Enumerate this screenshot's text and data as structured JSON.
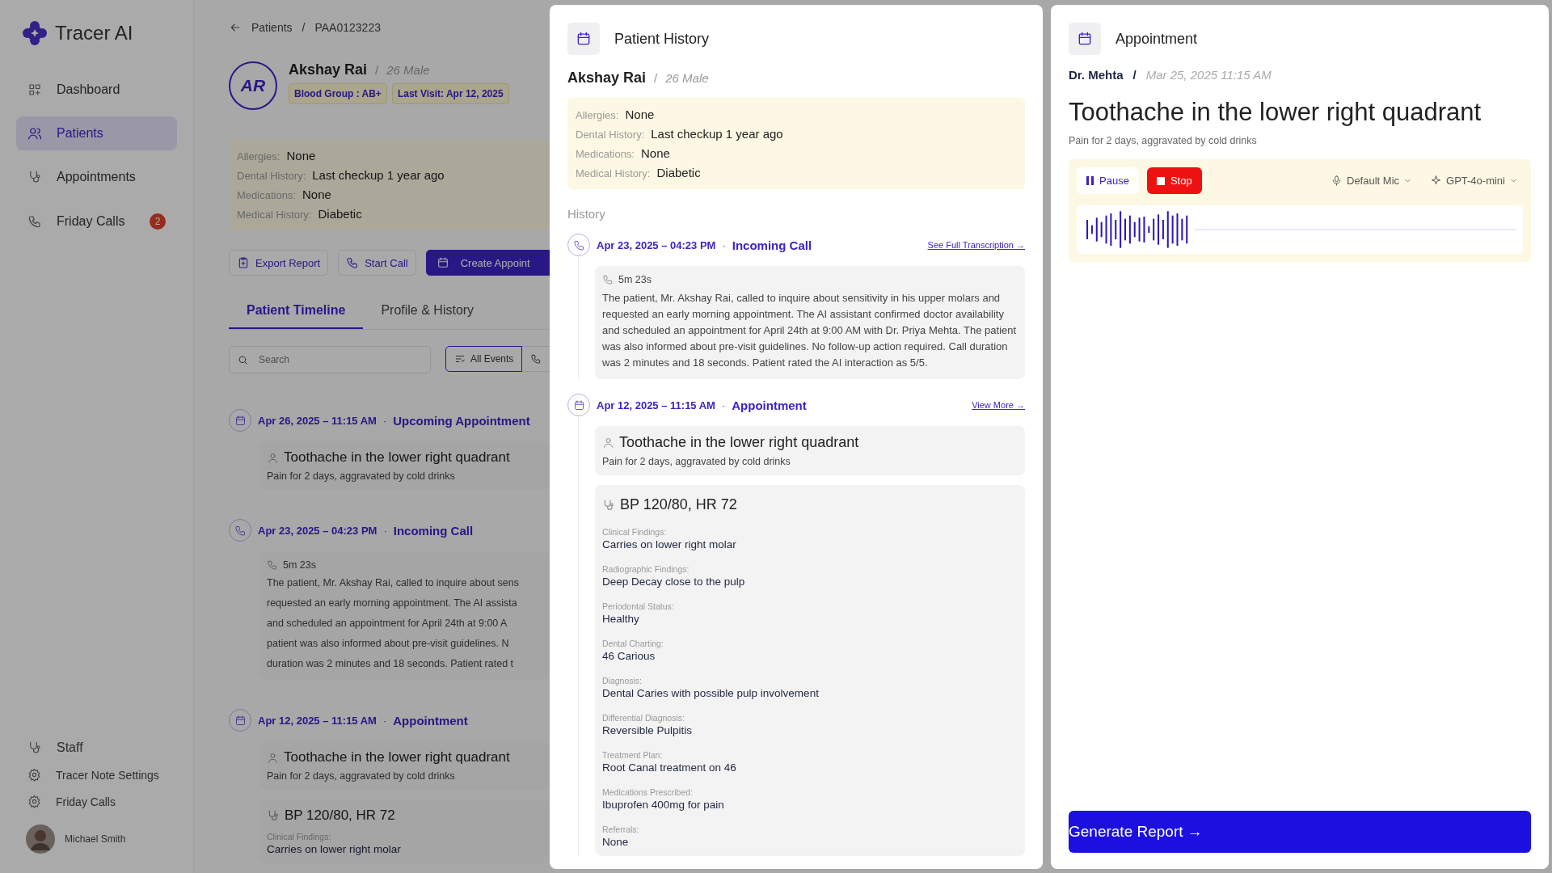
{
  "sidebar": {
    "brand": "Tracer AI",
    "nav": [
      {
        "label": "Dashboard",
        "selected": false
      },
      {
        "label": "Patients",
        "selected": true
      },
      {
        "label": "Appointments",
        "selected": false
      },
      {
        "label": "Friday Calls",
        "selected": false,
        "badge": "2"
      }
    ],
    "footer_nav": [
      {
        "label": "Staff"
      },
      {
        "label": "Tracer Note Settings"
      },
      {
        "label": "Friday Calls"
      }
    ],
    "user": {
      "name": "Michael Smith"
    }
  },
  "background": {
    "breadcrumb": [
      "Patients",
      "/",
      "PAA0123223"
    ],
    "patient": {
      "initials": "AR",
      "name": "Akshay Rai",
      "separator": "/",
      "meta": "26 Male",
      "badges": [
        "Blood Group : AB+",
        "Last Visit: Apr 12, 2025"
      ]
    },
    "info": [
      {
        "label": "Allergies:",
        "value": "None"
      },
      {
        "label": "Dental History:",
        "value": "Last checkup 1 year ago"
      },
      {
        "label": "Medications:",
        "value": "None"
      },
      {
        "label": "Medical History:",
        "value": "Diabetic"
      }
    ],
    "actions": [
      {
        "label": "Export Report",
        "kind": "outline"
      },
      {
        "label": "Start Call",
        "kind": "outline"
      },
      {
        "label": "Create Appoint",
        "kind": "primary"
      }
    ],
    "tabs": [
      {
        "label": "Patient Timeline",
        "selected": true
      },
      {
        "label": "Profile & History",
        "selected": false
      }
    ],
    "search": {
      "placeholder": "Search"
    },
    "filters": [
      {
        "label": "All Events",
        "selected": true
      },
      {
        "selected": false
      }
    ],
    "timeline": [
      {
        "kind": "appointment",
        "date": "Apr 26, 2025 – 11:15 AM",
        "separator": "·",
        "type": "Upcoming Appointment",
        "cards": [
          {
            "kind": "complaint",
            "title": "Toothache in the lower right quadrant",
            "subtitle": "Pain for 2 days, aggravated by cold drinks"
          }
        ]
      },
      {
        "kind": "call",
        "date": "Apr 23, 2025 –  04:23 PM",
        "separator": "·",
        "type": "Incoming Call",
        "duration": "5m 23s",
        "lines": [
          "The patient, Mr. Akshay Rai, called to inquire about sens",
          "requested an early morning appointment. The AI assista",
          "and scheduled an appointment for April 24th at 9:00 A",
          "patient was also informed about pre-visit guidelines. N",
          "duration was 2 minutes and 18 seconds. Patient rated t"
        ]
      },
      {
        "kind": "appointment",
        "date": "Apr 12, 2025 – 11:15 AM",
        "separator": "·",
        "type": "Appointment",
        "cards": [
          {
            "kind": "complaint",
            "title": "Toothache in the lower right quadrant",
            "subtitle": "Pain for 2 days, aggravated by cold drinks"
          },
          {
            "kind": "vitals",
            "title": "BP 120/80, HR 72",
            "fields": [
              {
                "label": "Clinical Findings:",
                "value": "Carries on lower right molar"
              }
            ]
          }
        ]
      }
    ]
  },
  "history_panel": {
    "title": "Patient History",
    "name": "Akshay Rai",
    "separator": "/",
    "meta": "26 Male",
    "info": [
      {
        "label": "Allergies:",
        "value": "None"
      },
      {
        "label": "Dental History:",
        "value": "Last checkup 1 year ago"
      },
      {
        "label": "Medications:",
        "value": "None"
      },
      {
        "label": "Medical History:",
        "value": "Diabetic"
      }
    ],
    "section_label": "History",
    "events": [
      {
        "kind": "call",
        "date": "Apr 23, 2025 –  04:23 PM",
        "separator": "·",
        "type": "Incoming Call",
        "link": "See Full Transcription →",
        "duration": "5m 23s",
        "lines": [
          "The patient, Mr. Akshay Rai, called to inquire about sensitivity in his upper molars and requested an early morning appointment. The AI assistant confirmed doctor availability and scheduled an appointment for April 24th at 9:00 AM with Dr. Priya Mehta. The patient was also informed about pre-visit guidelines. No follow-up action required. Call duration was 2 minutes and 18 seconds. Patient rated the AI interaction as 5/5."
        ]
      },
      {
        "kind": "appointment",
        "date": "Apr 12, 2025 – 11:15 AM",
        "separator": "·",
        "type": "Appointment",
        "link": "View More →",
        "cards": [
          {
            "kind": "complaint",
            "title": "Toothache in the lower right quadrant",
            "subtitle": "Pain for 2 days, aggravated by cold drinks"
          },
          {
            "kind": "vitals",
            "title": "BP 120/80, HR 72",
            "fields": [
              {
                "label": "Clinical Findings:",
                "value": "Carries on lower right molar"
              },
              {
                "label": "Radiographic Findings:",
                "value": "Deep Decay close to the pulp"
              },
              {
                "label": "Periodontal Status:",
                "value": "Healthy"
              },
              {
                "label": "Dental Charting:",
                "value": "46 Carious"
              },
              {
                "label": "Diagnosis:",
                "value": "Dental Caries with possible pulp involvement"
              },
              {
                "label": "Differential Diagnosis:",
                "value": "Reversible Pulpitis"
              },
              {
                "label": "Treatment Plan:",
                "value": "Root Canal treatment on 46"
              },
              {
                "label": "Medications Prescribed:",
                "value": "Ibuprofen 400mg for pain"
              },
              {
                "label": "Referrals:",
                "value": "None"
              }
            ]
          }
        ]
      }
    ]
  },
  "appointment_panel": {
    "title": "Appointment",
    "doctor": "Dr. Mehta",
    "separator": "/",
    "datetime": "Mar 25, 2025 11:15 AM",
    "heading": "Toothache in the lower right quadrant",
    "subtitle": "Pain for 2 days, aggravated by cold drinks",
    "recorder": {
      "pause": "Pause",
      "stop": "Stop",
      "mic": "Default Mic",
      "model": "GPT-4o-mini"
    },
    "generate": "Generate Report →"
  }
}
